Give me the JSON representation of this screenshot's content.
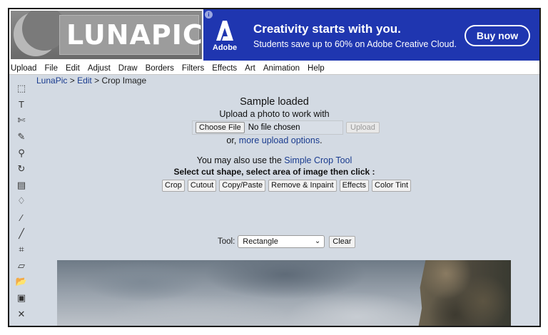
{
  "logo": {
    "text": "LUNAPIC"
  },
  "ad": {
    "info_glyph": "i",
    "brand": "Adobe",
    "headline": "Creativity starts with you.",
    "subline": "Students save up to 60% on Adobe Creative Cloud.",
    "cta": "Buy now",
    "brand_color": "#1f36b0"
  },
  "menu": [
    "Upload",
    "File",
    "Edit",
    "Adjust",
    "Draw",
    "Borders",
    "Filters",
    "Effects",
    "Art",
    "Animation",
    "Help"
  ],
  "toolbar": [
    {
      "icon": "select-icon",
      "glyph": "⬚"
    },
    {
      "icon": "text-icon",
      "glyph": "T"
    },
    {
      "icon": "scissors-icon",
      "glyph": "✄"
    },
    {
      "icon": "pencil-icon",
      "glyph": "✎"
    },
    {
      "icon": "zoom-icon",
      "glyph": "⚲"
    },
    {
      "icon": "rotate-icon",
      "glyph": "↻"
    },
    {
      "icon": "layers-icon",
      "glyph": "▤"
    },
    {
      "icon": "paint-bucket-icon",
      "glyph": "♢"
    },
    {
      "icon": "eyedropper-icon",
      "glyph": "⁄"
    },
    {
      "icon": "brush-icon",
      "glyph": "╱"
    },
    {
      "icon": "crop-icon",
      "glyph": "⌗"
    },
    {
      "icon": "eraser-icon",
      "glyph": "▱"
    },
    {
      "icon": "open-folder-icon",
      "glyph": "📂"
    },
    {
      "icon": "save-icon",
      "glyph": "▣"
    },
    {
      "icon": "close-icon",
      "glyph": "✕"
    }
  ],
  "breadcrumb": {
    "home": "LunaPic",
    "sep": " > ",
    "section": "Edit",
    "current": "Crop Image"
  },
  "status": {
    "title": "Sample loaded",
    "prompt": "Upload a photo to work with"
  },
  "file_input": {
    "choose_label": "Choose File",
    "value": "No file chosen",
    "upload_label": "Upload"
  },
  "more_upload": {
    "prefix": "or, ",
    "link": "more upload options",
    "suffix": "."
  },
  "also_use": {
    "prefix": "You may also use the ",
    "link": "Simple Crop Tool"
  },
  "instruction": "Select cut shape, select area of image then click :",
  "actions": [
    "Crop",
    "Cutout",
    "Copy/Paste",
    "Remove & Inpaint",
    "Effects",
    "Color Tint"
  ],
  "tool_select": {
    "label": "Tool:",
    "value": "Rectangle",
    "clear_label": "Clear"
  }
}
